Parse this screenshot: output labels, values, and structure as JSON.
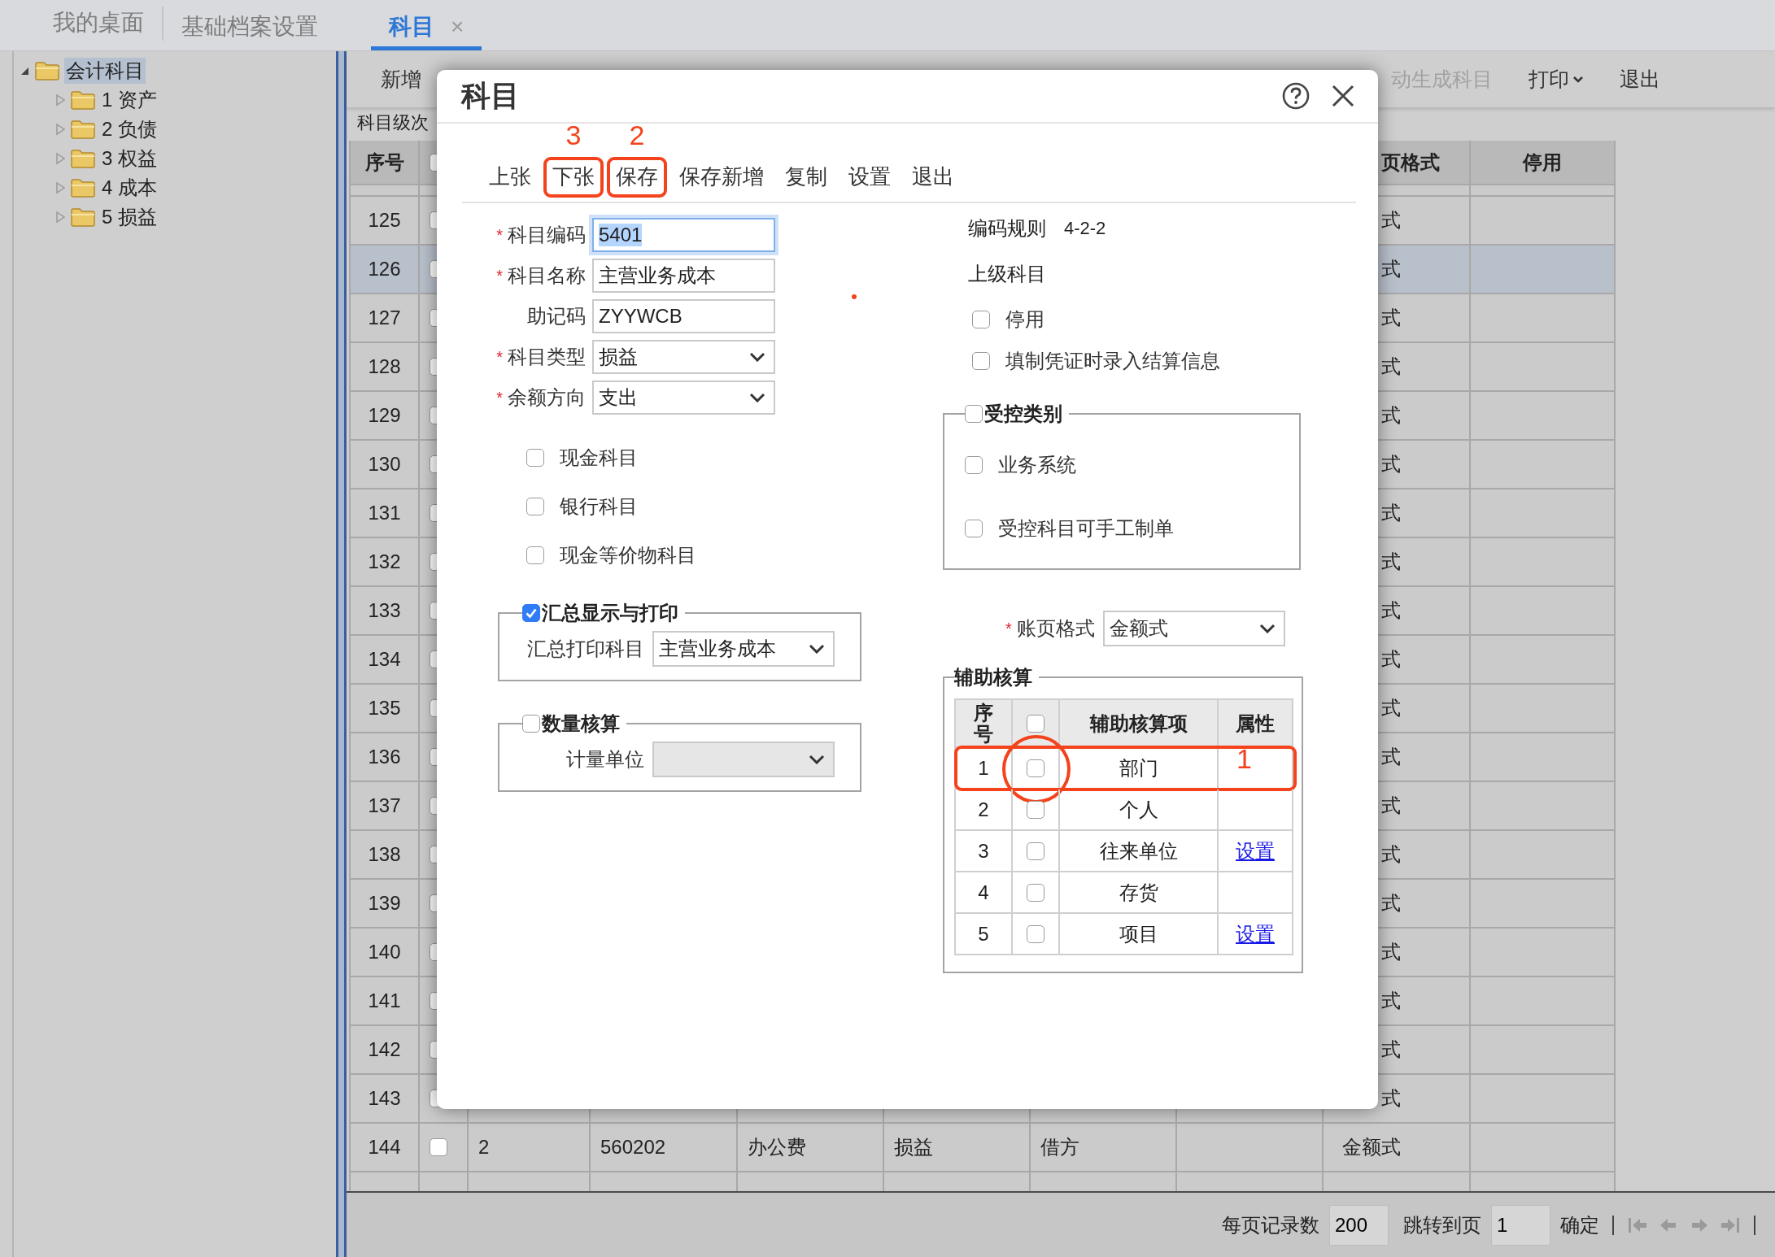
{
  "top_tabs": [
    {
      "label": "我的桌面",
      "selected": false
    },
    {
      "label": "基础档案设置",
      "selected": false
    },
    {
      "label": "科目",
      "selected": true,
      "close": "×"
    }
  ],
  "tree": {
    "label": "会计科目",
    "expanded": true,
    "selected": true,
    "children": [
      {
        "label": "1 资产",
        "expanded": false,
        "selected": false
      },
      {
        "label": "2 负债",
        "expanded": false,
        "selected": false
      },
      {
        "label": "3 权益",
        "expanded": false,
        "selected": false
      },
      {
        "label": "4 成本",
        "expanded": false,
        "selected": false
      },
      {
        "label": "5 损益",
        "expanded": false,
        "selected": false
      }
    ]
  },
  "toolbar": [
    {
      "label": "新增",
      "disabled": false,
      "dropdown": false
    },
    {
      "label": "动生成科目",
      "disabled": true,
      "dropdown": false
    },
    {
      "label": "打印",
      "disabled": false,
      "dropdown": true
    },
    {
      "label": "退出",
      "disabled": false,
      "dropdown": false
    }
  ],
  "level_label": "科目级次",
  "table": {
    "header": {
      "seq": "序号",
      "format": "页格式",
      "stop": "停用",
      "checked": false
    },
    "rows": [
      {
        "seq": "125",
        "checked": false,
        "format": "式",
        "selected": false
      },
      {
        "seq": "126",
        "checked": false,
        "format": "式",
        "selected": true
      },
      {
        "seq": "127",
        "checked": false,
        "format": "式",
        "selected": false
      },
      {
        "seq": "128",
        "checked": false,
        "format": "式",
        "selected": false
      },
      {
        "seq": "129",
        "checked": false,
        "format": "式",
        "selected": false
      },
      {
        "seq": "130",
        "checked": false,
        "format": "式",
        "selected": false
      },
      {
        "seq": "131",
        "checked": false,
        "format": "式",
        "selected": false
      },
      {
        "seq": "132",
        "checked": false,
        "format": "式",
        "selected": false
      },
      {
        "seq": "133",
        "checked": false,
        "format": "式",
        "selected": false
      },
      {
        "seq": "134",
        "checked": false,
        "format": "式",
        "selected": false
      },
      {
        "seq": "135",
        "checked": false,
        "format": "式",
        "selected": false
      },
      {
        "seq": "136",
        "checked": false,
        "format": "式",
        "selected": false
      },
      {
        "seq": "137",
        "checked": false,
        "format": "式",
        "selected": false
      },
      {
        "seq": "138",
        "checked": false,
        "format": "式",
        "selected": false
      },
      {
        "seq": "139",
        "checked": false,
        "format": "式",
        "selected": false
      },
      {
        "seq": "140",
        "checked": false,
        "format": "式",
        "selected": false
      },
      {
        "seq": "141",
        "checked": false,
        "format": "式",
        "selected": false
      },
      {
        "seq": "142",
        "checked": false,
        "format": "式",
        "selected": false
      },
      {
        "seq": "143",
        "checked": false,
        "format": "式",
        "selected": false
      },
      {
        "seq": "144",
        "checked": false,
        "grade": "2",
        "code": "560202",
        "name": "办公费",
        "type": "损益",
        "direction": "借方",
        "format": "金额式",
        "selected": false
      }
    ]
  },
  "pager": {
    "page_size_label": "每页记录数",
    "page_size": "200",
    "goto_label": "跳转到页",
    "page": "1",
    "confirm": "确定"
  },
  "dialog": {
    "title": "科目",
    "required_mark": "*",
    "toolbar": [
      {
        "label": "上张"
      },
      {
        "label": "下张",
        "marker": "3"
      },
      {
        "label": "保存",
        "marker": "2"
      },
      {
        "label": "保存新增"
      },
      {
        "label": "复制"
      },
      {
        "label": "设置"
      },
      {
        "label": "退出"
      }
    ],
    "fields": [
      {
        "label": "科目编码",
        "required": true,
        "kind": "input",
        "value": "5401",
        "focused": true
      },
      {
        "label": "科目名称",
        "required": true,
        "kind": "input",
        "value": "主营业务成本",
        "focused": false
      },
      {
        "label": "助记码",
        "required": false,
        "kind": "input",
        "value": "ZYYWCB",
        "focused": false
      },
      {
        "label": "科目类型",
        "required": true,
        "kind": "select",
        "value": "损益"
      },
      {
        "label": "余额方向",
        "required": true,
        "kind": "select",
        "value": "支出"
      }
    ],
    "checkboxes": [
      {
        "label": "现金科目",
        "checked": false
      },
      {
        "label": "银行科目",
        "checked": false
      },
      {
        "label": "现金等价物科目",
        "checked": false
      }
    ],
    "summary_group": {
      "title": "汇总显示与打印",
      "checked": true,
      "field_label": "汇总打印科目",
      "value": "主营业务成本",
      "disabled": false
    },
    "quantity_group": {
      "title": "数量核算",
      "checked": false,
      "field_label": "计量单位",
      "disabled": true
    },
    "coding_rule": {
      "label": "编码规则",
      "value": "4-2-2"
    },
    "parent_label": "上级科目",
    "right_checkboxes": [
      {
        "label": "停用",
        "checked": false
      },
      {
        "label": "填制凭证时录入结算信息",
        "checked": false
      }
    ],
    "control_group": {
      "title": "受控类别",
      "checked": false,
      "items": [
        {
          "label": "业务系统",
          "checked": false
        },
        {
          "label": "受控科目可手工制单",
          "checked": false
        }
      ]
    },
    "ledger_format": {
      "label": "账页格式",
      "required": true,
      "value": "金额式"
    },
    "aux": {
      "title": "辅助核算",
      "columns": [
        "序号",
        "辅助核算项",
        "属性"
      ],
      "header_checked": false,
      "rows": [
        {
          "seq": "1",
          "checked": false,
          "item": "部门",
          "marker": "1"
        },
        {
          "seq": "2",
          "checked": false,
          "item": "个人"
        },
        {
          "seq": "3",
          "checked": false,
          "item": "往来单位",
          "attr": "设置"
        },
        {
          "seq": "4",
          "checked": false,
          "item": "存货"
        },
        {
          "seq": "5",
          "checked": false,
          "item": "项目",
          "attr": "设置"
        }
      ]
    }
  }
}
